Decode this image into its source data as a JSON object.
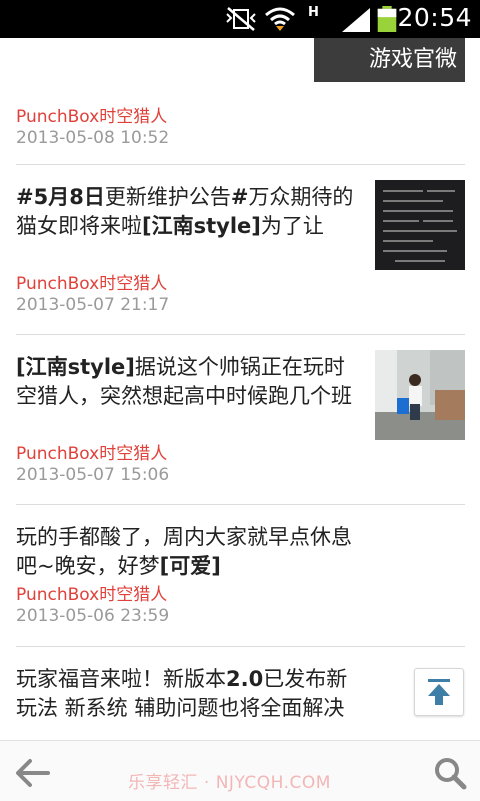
{
  "status_bar": {
    "time": "20:54",
    "network_type": "H",
    "icons": [
      "vibrate-mute-icon",
      "wifi-icon",
      "signal-icon",
      "battery-icon"
    ]
  },
  "header": {
    "title": "游戏官微"
  },
  "feed": {
    "items": [
      {
        "text_parts": [],
        "author": "PunchBox时空猎人",
        "date": "2013-05-08 10:52",
        "has_thumbnail": false
      },
      {
        "text_parts": [
          {
            "t": "#5月8日",
            "b": true
          },
          {
            "t": "更新维护公告",
            "b": false
          },
          {
            "t": "#",
            "b": true
          },
          {
            "t": "万众期待的猫女即将来啦",
            "b": false
          },
          {
            "t": "[江南style]",
            "b": true
          },
          {
            "t": "为了让",
            "b": false
          }
        ],
        "author": "PunchBox时空猎人",
        "date": "2013-05-07 21:17",
        "has_thumbnail": true,
        "thumbnail": "dark-text-screenshot-thumbnail"
      },
      {
        "text_parts": [
          {
            "t": "[江南style]",
            "b": true
          },
          {
            "t": "据说这个帅锅正在玩时空猎人，突然想起高中时候跑几个班",
            "b": false
          }
        ],
        "author": "PunchBox时空猎人",
        "date": "2013-05-07 15:06",
        "has_thumbnail": true,
        "thumbnail": "person-in-room-photo-thumbnail"
      },
      {
        "text_parts": [
          {
            "t": "玩的手都酸了，周内大家就早点休息吧~晚安，好梦",
            "b": false
          },
          {
            "t": "[可爱]",
            "b": true
          }
        ],
        "author": "PunchBox时空猎人",
        "date": "2013-05-06 23:59",
        "has_thumbnail": false
      },
      {
        "text_parts": [
          {
            "t": "玩家福音来啦！新版本",
            "b": false
          },
          {
            "t": "2.0",
            "b": true
          },
          {
            "t": "已发布新玩法 新系统 辅助问题也将全面解决",
            "b": false
          }
        ],
        "author": "",
        "date": "",
        "has_thumbnail": false
      }
    ]
  },
  "controls": {
    "scroll_top_icon": "arrow-up-to-top-icon"
  },
  "bottom_bar": {
    "back_icon": "back-arrow-icon",
    "search_icon": "search-icon",
    "watermark": "乐享轻汇 · NJYCQH.COM"
  },
  "colors": {
    "author": "#e0413a",
    "date": "#9a9a9a",
    "status_bar": "#000000",
    "header_bg": "#3c3c3c"
  }
}
